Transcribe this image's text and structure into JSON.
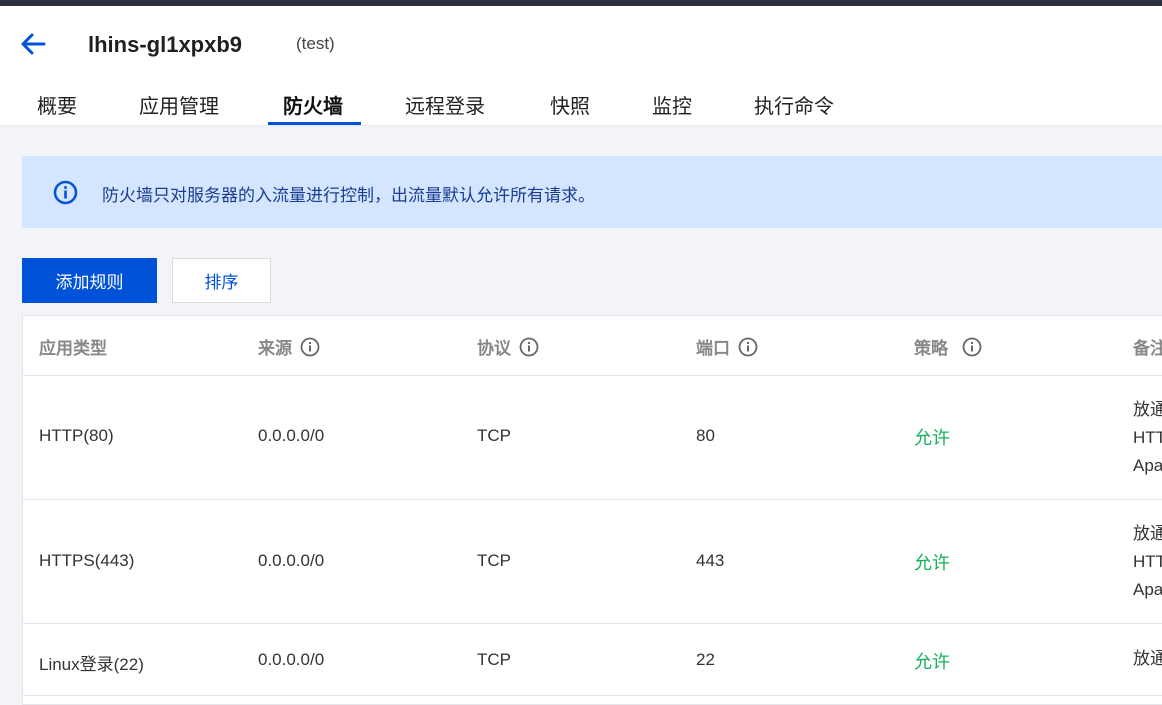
{
  "header": {
    "instance_name": "lhins-gl1xpxb9",
    "instance_alias": "(test)"
  },
  "tabs": [
    {
      "label": "概要"
    },
    {
      "label": "应用管理"
    },
    {
      "label": "防火墙"
    },
    {
      "label": "远程登录"
    },
    {
      "label": "快照"
    },
    {
      "label": "监控"
    },
    {
      "label": "执行命令"
    }
  ],
  "active_tab": "防火墙",
  "notice": {
    "text": "防火墙只对服务器的入流量进行控制，出流量默认允许所有请求。"
  },
  "toolbar": {
    "add_rule_label": "添加规则",
    "sort_label": "排序"
  },
  "table": {
    "columns": [
      "应用类型",
      "来源",
      "协议",
      "端口",
      "策略",
      "备注"
    ],
    "rows": [
      {
        "app": "HTTP(80)",
        "source": "0.0.0.0/0",
        "protocol": "TCP",
        "port": "80",
        "policy": "允许",
        "remark": [
          "放通",
          "HTT",
          "Apa"
        ]
      },
      {
        "app": "HTTPS(443)",
        "source": "0.0.0.0/0",
        "protocol": "TCP",
        "port": "443",
        "policy": "允许",
        "remark": [
          "放通",
          "HTT",
          "Apa"
        ]
      },
      {
        "app": "Linux登录(22)",
        "source": "0.0.0.0/0",
        "protocol": "TCP",
        "port": "22",
        "policy": "允许",
        "remark": [
          "放通"
        ]
      }
    ]
  },
  "colors": {
    "primary": "#0052d9",
    "allow": "#15b25a",
    "notice_bg": "#d4e5ff"
  }
}
